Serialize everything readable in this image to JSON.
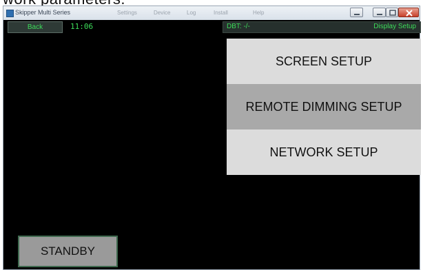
{
  "caption_fragment": "work parameters.",
  "window": {
    "title": "Skipper Multi Series",
    "menu_items": [
      "Settings",
      "Device",
      "Log",
      "Install",
      "Help"
    ]
  },
  "topbar": {
    "back_label": "Back",
    "clock": "11:06",
    "dbt": "DBT: -/-",
    "mode_label": "Display Setup",
    "text_color": "#3ddc5a"
  },
  "menu": {
    "items": [
      {
        "label": "SCREEN SETUP"
      },
      {
        "label": "REMOTE DIMMING SETUP",
        "state": "highlighted"
      },
      {
        "label": "NETWORK SETUP"
      }
    ]
  },
  "standby_label": "STANDBY",
  "colors": {
    "background": "#000000",
    "menu_item": "#dcdcdc",
    "menu_item_highlight": "#a9a9a9",
    "standby_border": "#3f6a4f"
  },
  "icons": {
    "app": "app-icon",
    "minimize": "minimize-icon",
    "maximize": "maximize-icon",
    "close": "close-icon"
  }
}
